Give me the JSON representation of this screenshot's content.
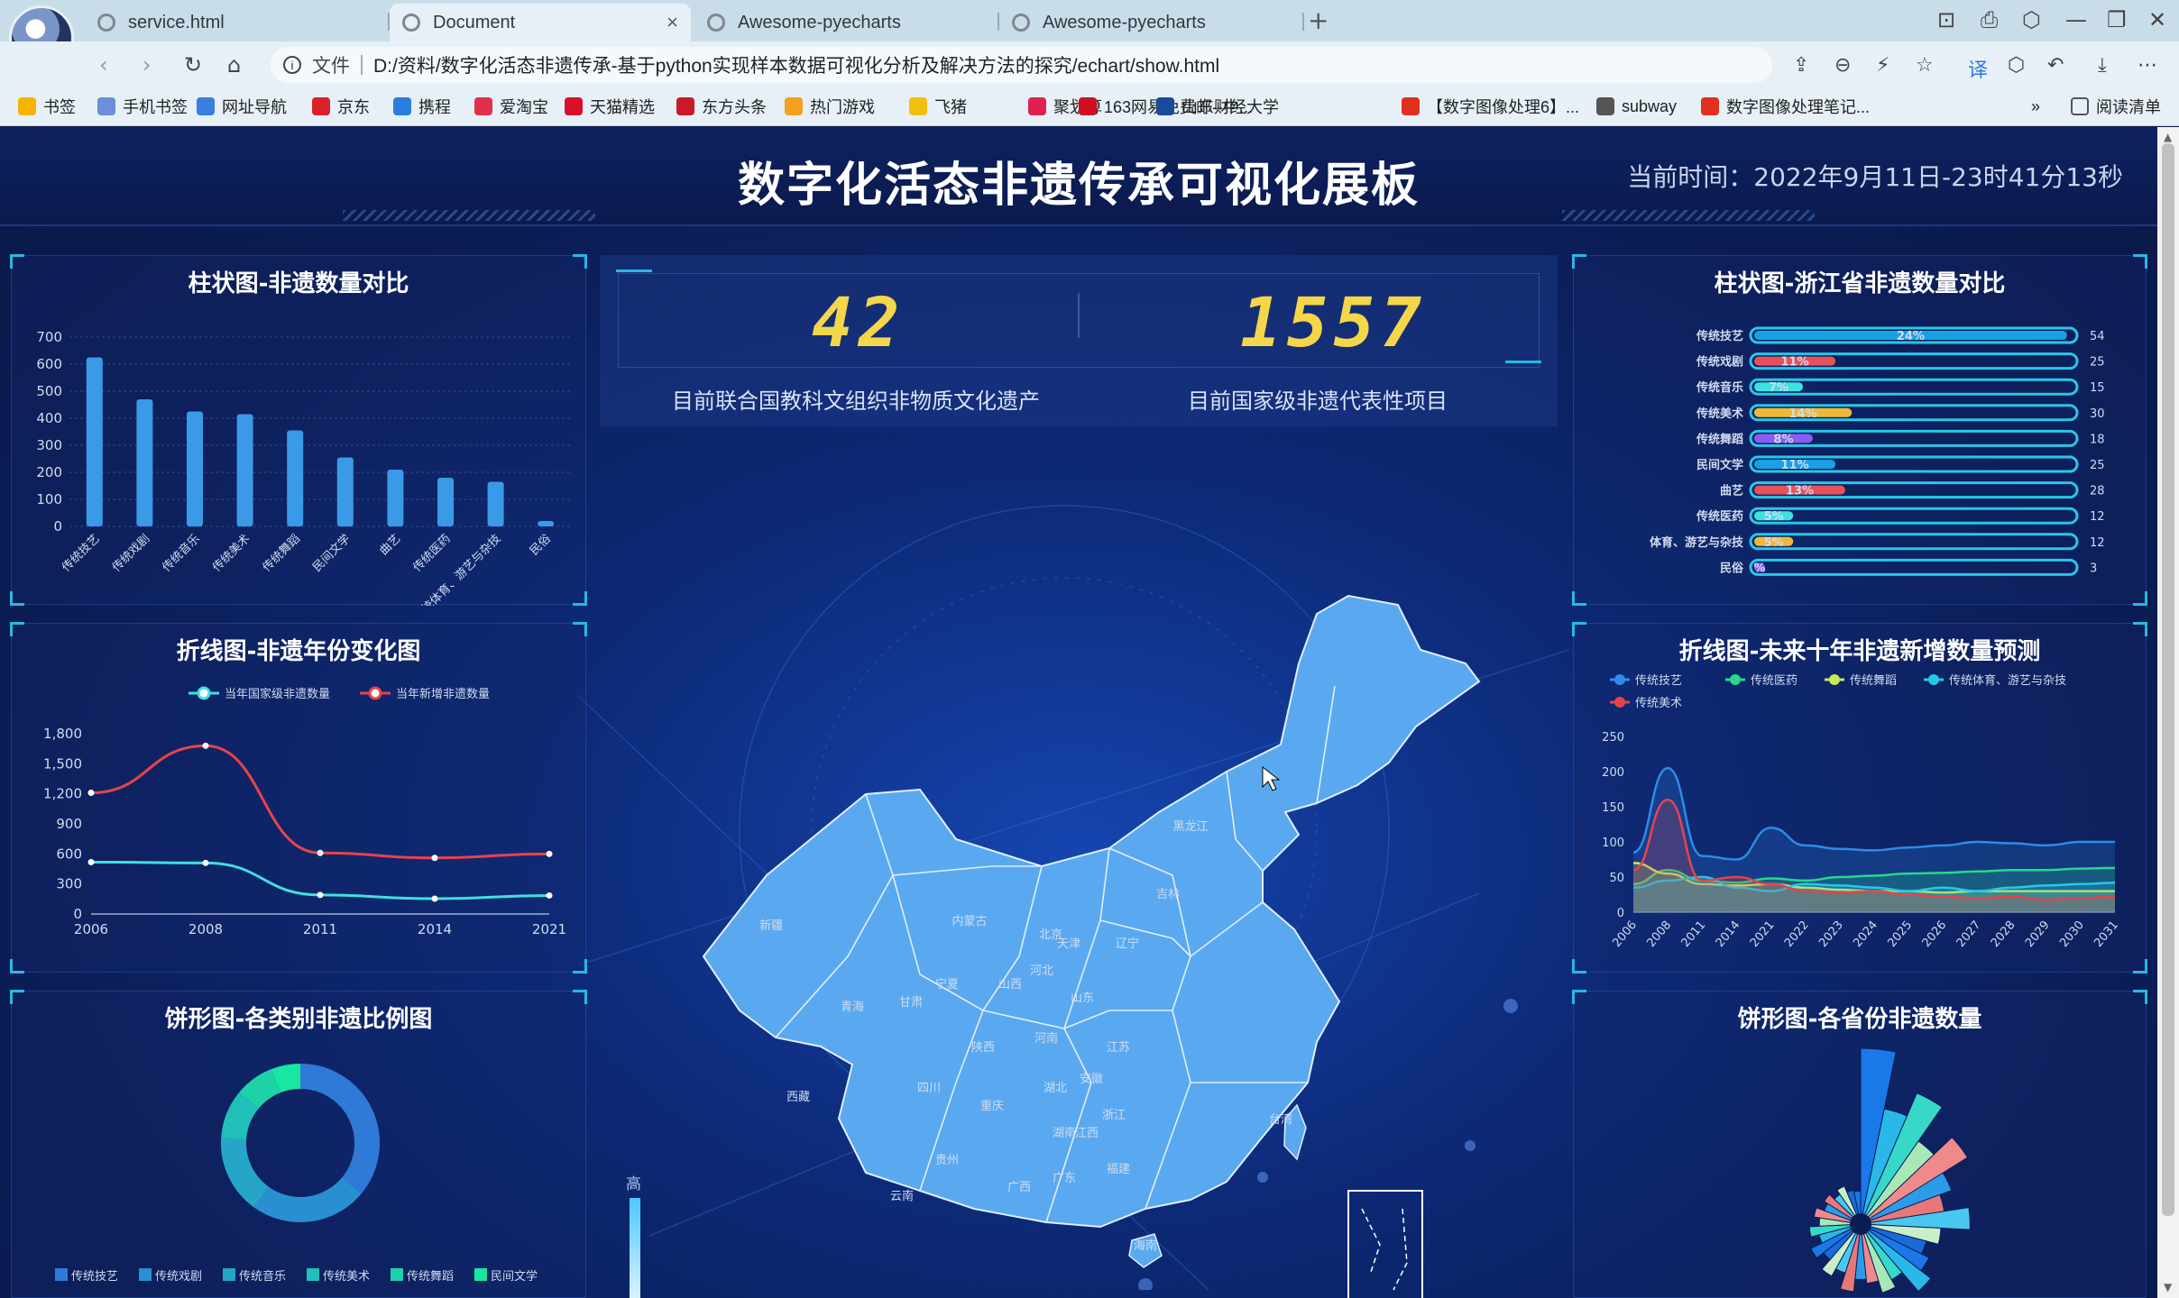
{
  "browser": {
    "tabs": [
      {
        "label": "service.html",
        "active": false
      },
      {
        "label": "Document",
        "active": true
      },
      {
        "label": "Awesome-pyecharts",
        "active": false
      },
      {
        "label": "Awesome-pyecharts",
        "active": false
      }
    ],
    "new_tab": "+",
    "url_prefix": "文件",
    "url": "D:/资料/数字化活态非遗传承-基于python实现样本数据可视化分析及解决方法的探究/echart/show.html",
    "bookmarks": [
      {
        "label": "书签",
        "color": "#f5b400"
      },
      {
        "label": "手机书签",
        "color": "#6b8fd8"
      },
      {
        "label": "网址导航",
        "color": "#3a7ee0"
      },
      {
        "label": "京东",
        "color": "#d8232a"
      },
      {
        "label": "携程",
        "color": "#2c7de0"
      },
      {
        "label": "爱淘宝",
        "color": "#e0304a"
      },
      {
        "label": "天猫精选",
        "color": "#d8102a"
      },
      {
        "label": "东方头条",
        "color": "#c81a2a"
      },
      {
        "label": "热门游戏",
        "color": "#f5a020"
      },
      {
        "label": "飞猪",
        "color": "#f0c010"
      },
      {
        "label": "聚划算",
        "color": "#e02050"
      },
      {
        "label": "163网易免费邮--中...",
        "color": "#d01020"
      },
      {
        "label": "山东财经大学",
        "color": "#1a4a9a"
      },
      {
        "label": "【数字图像处理6】...",
        "color": "#e03020"
      },
      {
        "label": "subway",
        "color": "#555555"
      },
      {
        "label": "数字图像处理笔记...",
        "color": "#e03020"
      }
    ],
    "more": "»",
    "reading_list": "阅读清单"
  },
  "header": {
    "title": "数字化活态非遗传承可视化展板",
    "time": "当前时间：2022年9月11日-23时41分13秒"
  },
  "kpi": {
    "unesco_value": "42",
    "unesco_label": "目前联合国教科文组织非物质文化遗产",
    "national_value": "1557",
    "national_label": "目前国家级非遗代表性项目"
  },
  "panels": {
    "bar1_title": "柱状图-非遗数量对比",
    "line1_title": "折线图-非遗年份变化图",
    "pie1_title": "饼形图-各类别非遗比例图",
    "hbar_title": "柱状图-浙江省非遗数量对比",
    "line2_title": "折线图-未来十年非遗新增数量预测",
    "pie2_title": "饼形图-各省份非遗数量"
  },
  "map": {
    "provinces": [
      "新疆",
      "西藏",
      "青海",
      "甘肃",
      "内蒙古",
      "宁夏",
      "陕西",
      "四川",
      "重庆",
      "云南",
      "贵州",
      "广西",
      "广东",
      "海南",
      "湖南",
      "湖北",
      "河南",
      "山西",
      "河北",
      "北京",
      "天津",
      "山东",
      "江苏",
      "安徽",
      "浙江",
      "江西",
      "福建",
      "辽宁",
      "吉林",
      "黑龙江",
      "台湾"
    ],
    "visual_high": "高",
    "fill": "#5aa9f0"
  },
  "chart_data": [
    {
      "type": "bar",
      "categories": [
        "传统技艺",
        "传统戏剧",
        "传统音乐",
        "传统美术",
        "传统舞蹈",
        "民间文学",
        "曲艺",
        "传统医药",
        "传统体育、游艺与杂技",
        "民俗"
      ],
      "values": [
        625,
        470,
        425,
        415,
        355,
        255,
        210,
        180,
        165,
        20
      ],
      "ylim": [
        0,
        700
      ],
      "yticks": [
        "700",
        "600",
        "500",
        "400",
        "300",
        "200",
        "100",
        "0"
      ]
    },
    {
      "type": "line",
      "x": [
        "2006",
        "2008",
        "2011",
        "2014",
        "2021"
      ],
      "series": [
        {
          "name": "当年国家级非遗数量",
          "values": [
            518,
            510,
            190,
            153,
            185
          ],
          "color": "#3ee0e0"
        },
        {
          "name": "当年新增非遗数量",
          "values": [
            1210,
            1680,
            610,
            560,
            600
          ],
          "color": "#e8434a"
        }
      ],
      "ylim": [
        0,
        1800
      ],
      "yticks": [
        "1,800",
        "1,500",
        "1,200",
        "900",
        "600",
        "300",
        "0"
      ]
    },
    {
      "type": "pie",
      "donut": true,
      "legend": [
        "传统技艺",
        "传统戏剧",
        "传统音乐",
        "传统美术",
        "传统舞蹈",
        "民间文学"
      ],
      "colors": [
        "#2f7ad6",
        "#2a8fd0",
        "#25a6c8",
        "#20bfb8",
        "#1ed2a8",
        "#19e6a0"
      ],
      "values": [
        36,
        24,
        16,
        10,
        8,
        6
      ]
    },
    {
      "type": "bar",
      "orientation": "horizontal",
      "categories": [
        "传统技艺",
        "传统戏剧",
        "传统音乐",
        "传统美术",
        "传统舞蹈",
        "民间文学",
        "曲艺",
        "传统医药",
        "体育、游艺与杂技",
        "民俗"
      ],
      "values": [
        54,
        25,
        15,
        30,
        18,
        25,
        28,
        12,
        12,
        3
      ],
      "percent_labels": [
        "24%",
        "11%",
        "7%",
        "14%",
        "8%",
        "11%",
        "13%",
        "5%",
        "5%",
        "%"
      ],
      "colors": [
        "#1aa0e6",
        "#e8505a",
        "#3ee0e0",
        "#f0b838",
        "#8a5cf0",
        "#1aa0e6",
        "#e8505a",
        "#3ee0e0",
        "#f0b838",
        "#8a5cf0"
      ]
    },
    {
      "type": "area",
      "x": [
        "2006",
        "2008",
        "2011",
        "2014",
        "2021",
        "2022",
        "2023",
        "2024",
        "2025",
        "2026",
        "2027",
        "2028",
        "2029",
        "2030",
        "2031"
      ],
      "series": [
        {
          "name": "传统技艺",
          "color": "#2c8ce8",
          "values": [
            85,
            205,
            80,
            75,
            120,
            95,
            90,
            88,
            92,
            95,
            100,
            98,
            95,
            100,
            100
          ]
        },
        {
          "name": "传统医药",
          "color": "#27d88a",
          "values": [
            40,
            60,
            45,
            42,
            48,
            45,
            50,
            52,
            55,
            56,
            58,
            60,
            60,
            62,
            63
          ]
        },
        {
          "name": "传统舞蹈",
          "color": "#c8e860",
          "values": [
            70,
            55,
            40,
            38,
            40,
            35,
            32,
            30,
            30,
            28,
            30,
            30,
            30,
            30,
            30
          ]
        },
        {
          "name": "传统体育、游艺与杂技",
          "color": "#27c8e8",
          "values": [
            35,
            45,
            50,
            35,
            30,
            40,
            38,
            35,
            30,
            35,
            30,
            35,
            38,
            40,
            42
          ]
        },
        {
          "name": "传统美术",
          "color": "#e8434a",
          "values": [
            60,
            160,
            45,
            50,
            40,
            30,
            28,
            30,
            25,
            22,
            20,
            22,
            18,
            20,
            22
          ]
        }
      ],
      "ylim": [
        0,
        250
      ],
      "yticks": [
        "250",
        "200",
        "150",
        "100",
        "50",
        "0"
      ]
    },
    {
      "type": "pie",
      "rose": true,
      "colors": [
        "#1a78e8",
        "#2ab8e8",
        "#38d8c8",
        "#a8e8b8",
        "#f08a8a",
        "#2c9ce8",
        "#e87878",
        "#48c8f0",
        "#c8f0c8",
        "#1a6ad8"
      ],
      "values": [
        190,
        120,
        150,
        100,
        130,
        95,
        80,
        110,
        75,
        60,
        70,
        85,
        55,
        65,
        50,
        45,
        60,
        40,
        50,
        35,
        45,
        30,
        40,
        28,
        35,
        25,
        30,
        22,
        28,
        20,
        18
      ]
    }
  ]
}
